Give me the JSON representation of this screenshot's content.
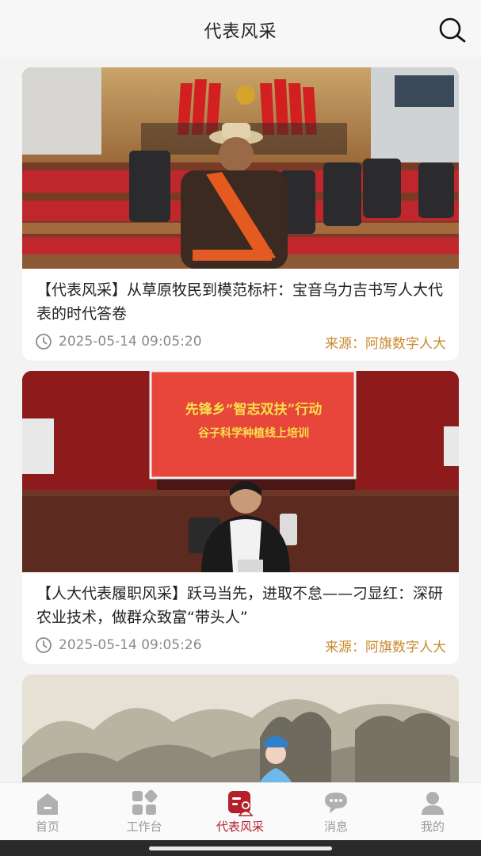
{
  "header": {
    "title": "代表风采",
    "search_icon": "search-icon"
  },
  "feed": {
    "articles": [
      {
        "title": "【代表风采】从草原牧民到模范标杆：宝音乌力吉书写人大代表的时代答卷",
        "time": "2025-05-14 09:05:20",
        "source": "来源：阿旗数字人大",
        "image": "delegate in robes and sash in a congress hall with red flags"
      },
      {
        "title": "【人大代表履职风采】跃马当先，进取不怠——刁显红：深研农业技术，做群众致富“带头人”",
        "time": "2025-05-14 09:05:26",
        "source": "来源：阿旗数字人大",
        "image": "woman giving a training talk in front of a projector screen",
        "banner_line1": "先锋乡“智志双扶”行动",
        "banner_line2": "谷子科学种植线上培训"
      },
      {
        "title": "",
        "time": "",
        "source": "",
        "image": "opera performer in front of a landscape painting"
      }
    ]
  },
  "tabbar": {
    "items": [
      {
        "label": "首页",
        "icon": "home-icon",
        "active": false
      },
      {
        "label": "工作台",
        "icon": "grid-icon",
        "active": false
      },
      {
        "label": "代表风采",
        "icon": "delegate-icon",
        "active": true
      },
      {
        "label": "消息",
        "icon": "message-icon",
        "active": false
      },
      {
        "label": "我的",
        "icon": "profile-icon",
        "active": false
      }
    ]
  },
  "colors": {
    "accent": "#b3202a",
    "source": "#c98a2e",
    "time": "#8a8a8a"
  }
}
